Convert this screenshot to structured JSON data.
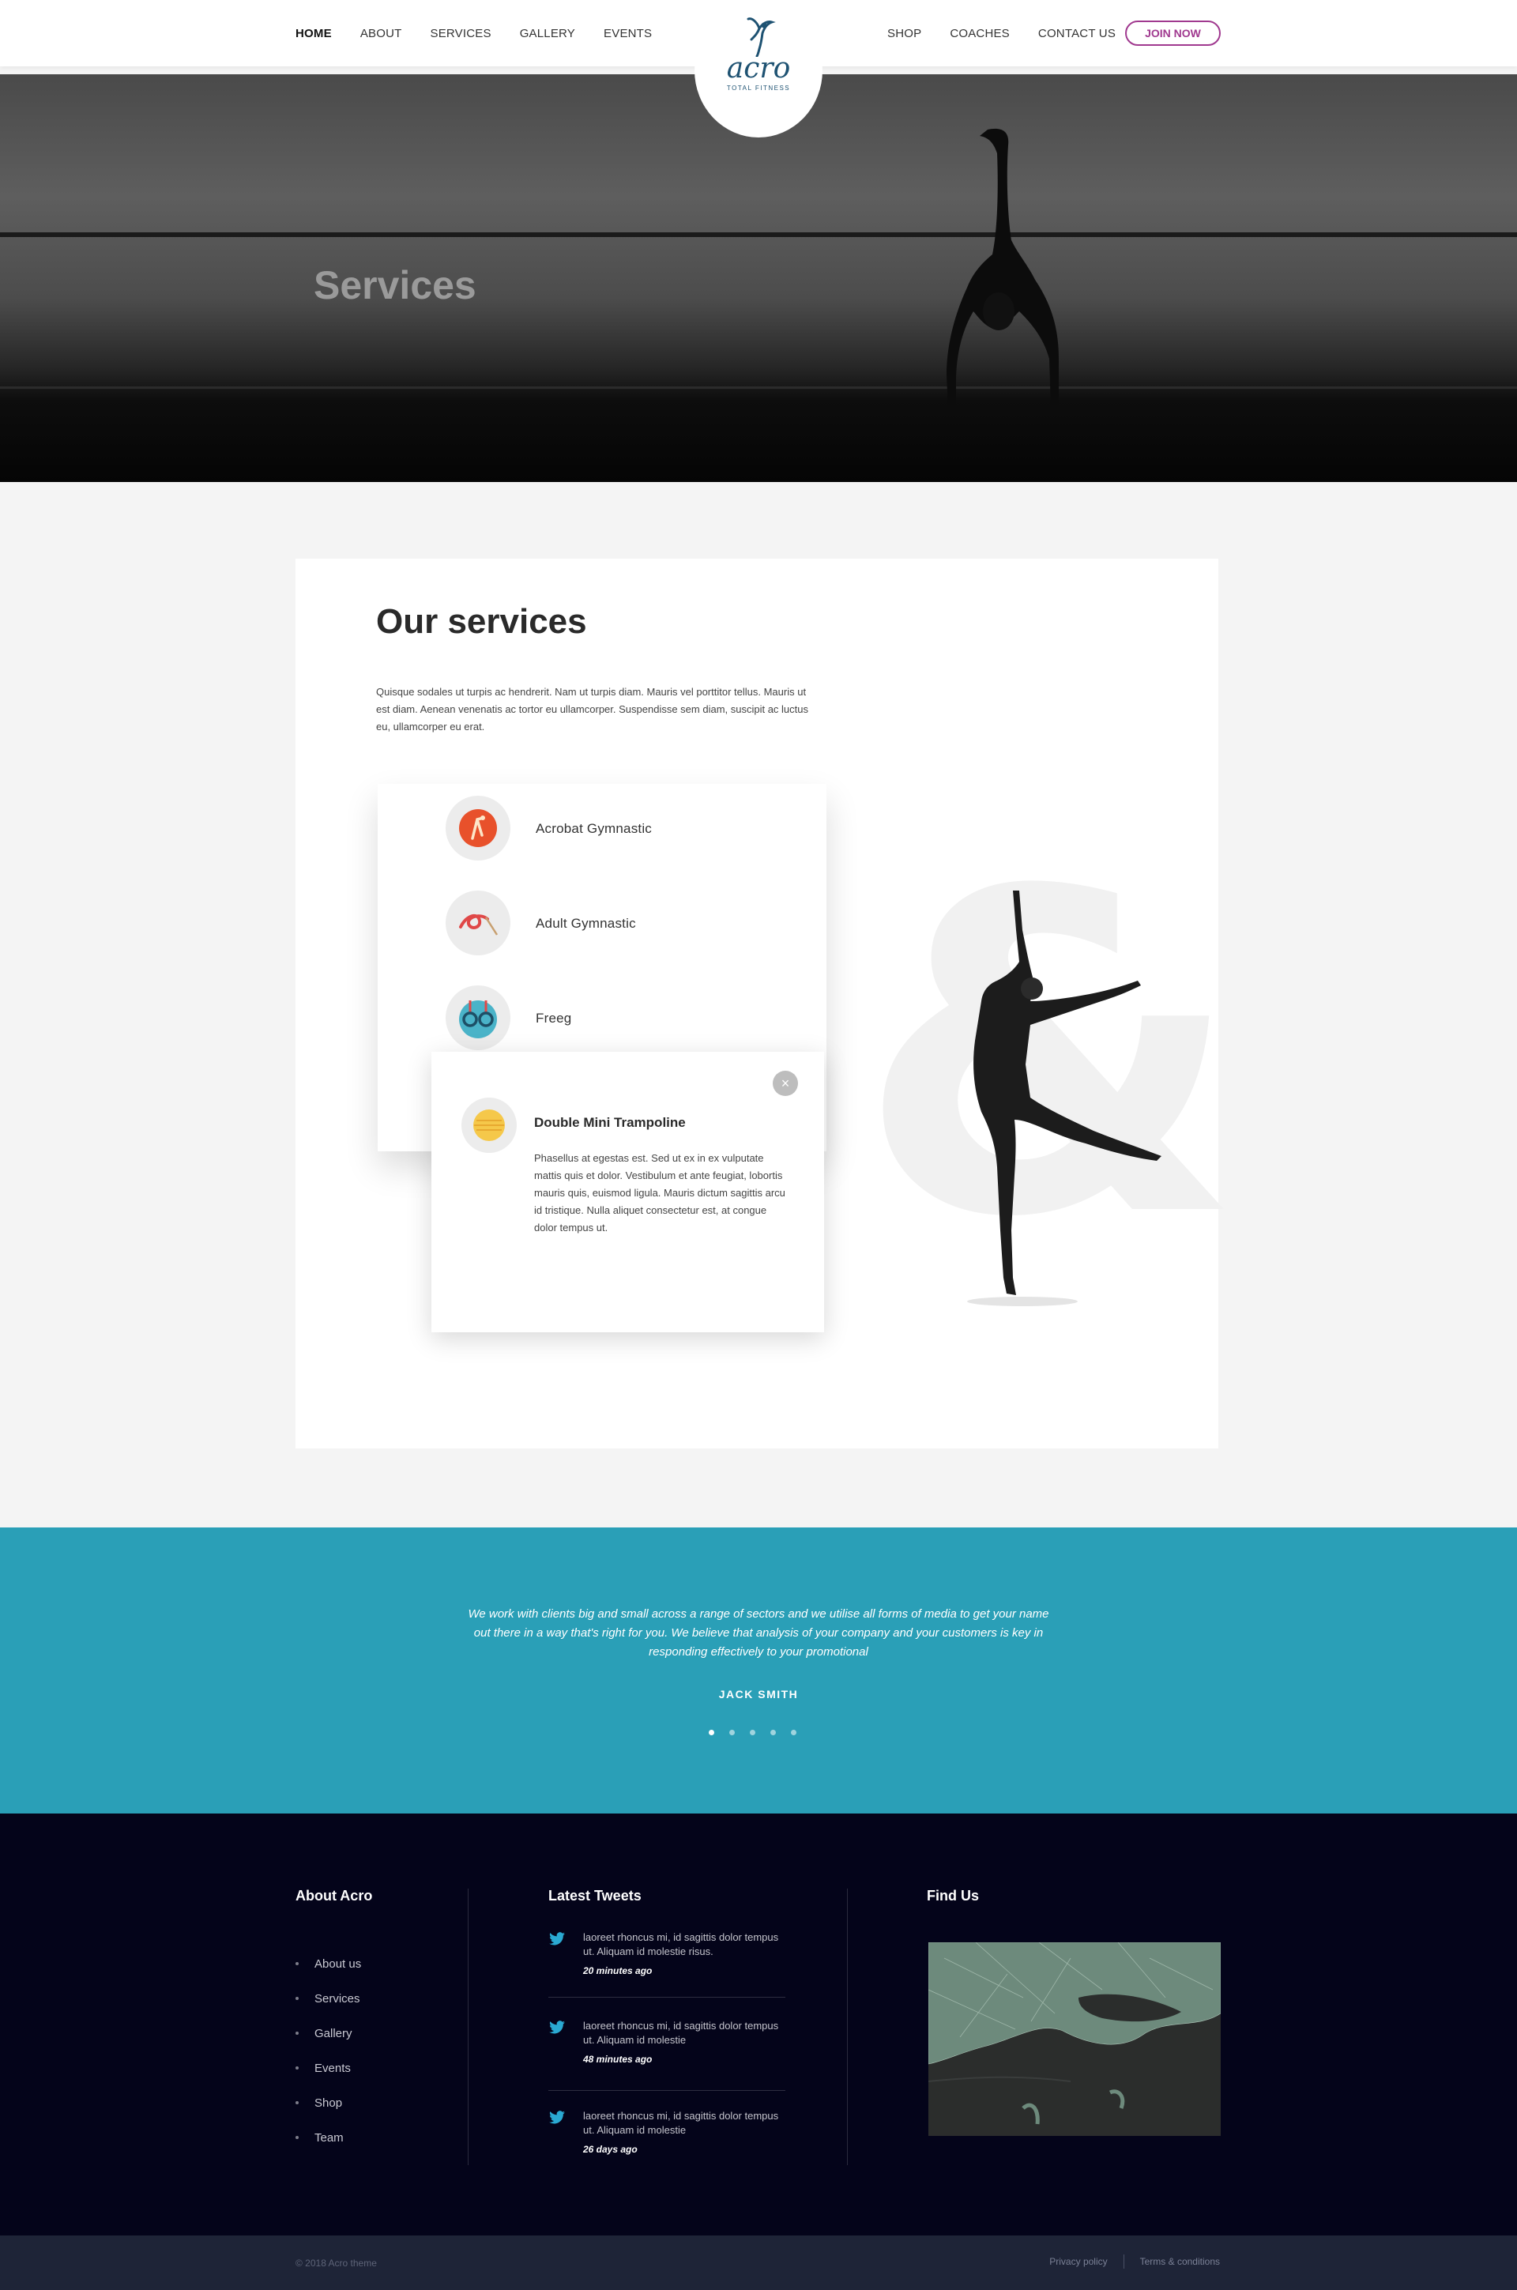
{
  "header": {
    "nav_left": [
      "HOME",
      "ABOUT",
      "SERVICES",
      "GALLERY",
      "EVENTS"
    ],
    "nav_right": [
      "SHOP",
      "COACHES",
      "CONTACT US"
    ],
    "join_label": "JOIN NOW",
    "logo_word": "acro",
    "logo_sub": "TOTAL FITNESS"
  },
  "hero": {
    "title": "Services"
  },
  "services": {
    "title": "Our services",
    "description": "Quisque sodales ut turpis ac hendrerit. Nam ut turpis diam. Mauris vel porttitor tellus. Mauris ut est diam. Aenean venenatis ac tortor eu ullamcorper. Suspendisse sem diam, suscipit ac luctus eu, ullamcorper eu erat.",
    "items": [
      {
        "label": "Acrobat Gymnastic",
        "icon": "acrobat-icon"
      },
      {
        "label": "Adult Gymnastic",
        "icon": "ribbon-icon"
      },
      {
        "label": "Freeg",
        "icon": "rings-icon"
      }
    ],
    "popup": {
      "title": "Double Mini Trampoline",
      "text": "Phasellus at egestas est. Sed ut ex in ex vulputate mattis quis et dolor. Vestibulum et ante feugiat, lobortis mauris quis, euismod ligula. Mauris dictum sagittis arcu id tristique. Nulla aliquet consectetur est, at congue dolor tempus ut.",
      "close_symbol": "×"
    },
    "decor_symbol": "&"
  },
  "testimonial": {
    "quote": "We work with clients big and small across a range of sectors and we utilise all forms of media to get your name out there in a way that's right for you. We believe that analysis of your company and your customers is key in responding effectively to your promotional",
    "author": "JACK SMITH",
    "slides": 5,
    "active_slide": 1
  },
  "footer": {
    "about_title": "About Acro",
    "about_links": [
      "About us",
      "Services",
      "Gallery",
      "Events",
      "Shop",
      "Team"
    ],
    "tweets_title": "Latest Tweets",
    "tweets": [
      {
        "text": "laoreet rhoncus mi, id sagittis dolor tempus ut. Aliquam id molestie risus.",
        "time": "20 minutes ago"
      },
      {
        "text": "laoreet rhoncus mi, id sagittis dolor tempus ut. Aliquam id molestie",
        "time": "48 minutes ago"
      },
      {
        "text": "laoreet rhoncus mi, id sagittis dolor tempus ut. Aliquam id molestie",
        "time": "26 days ago"
      }
    ],
    "find_title": "Find Us",
    "copyright": "© 2018 Acro theme",
    "privacy": "Privacy policy",
    "terms": "Terms & conditions"
  },
  "colors": {
    "accent": "#a0398f",
    "teal": "#2a9fb7",
    "footer_bg": "#04041a",
    "logo": "#1e5272"
  }
}
